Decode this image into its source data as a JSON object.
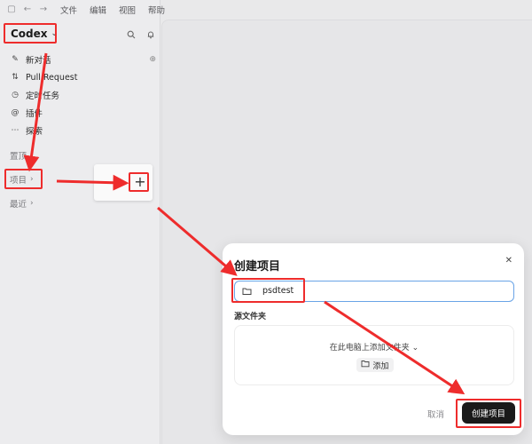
{
  "menubar": {
    "menus": [
      "文件",
      "编辑",
      "视图",
      "帮助"
    ]
  },
  "sidebar": {
    "app_name": "Codex",
    "nav": [
      {
        "label": "新对话",
        "icon": "edit-icon"
      },
      {
        "label": "Pull Request",
        "icon": "pull-request-icon"
      },
      {
        "label": "定时任务",
        "icon": "clock-icon"
      },
      {
        "label": "插件",
        "icon": "at-icon"
      },
      {
        "label": "探索",
        "icon": "more-icon"
      }
    ],
    "pinned_label": "置顶",
    "projects_label": "项目",
    "recent_label": "最近"
  },
  "popup": {
    "plus": "+"
  },
  "dialog": {
    "title": "创建项目",
    "name_value": "psdtest",
    "source_label": "源文件夹",
    "source_hint": "在此电脑上添加文件夹",
    "add_label": "添加",
    "cancel_label": "取消",
    "create_label": "创建项目"
  },
  "colors": {
    "annotation": "#ee2c2c",
    "focus": "#6aa4e6",
    "primary": "#1a1a1a"
  }
}
